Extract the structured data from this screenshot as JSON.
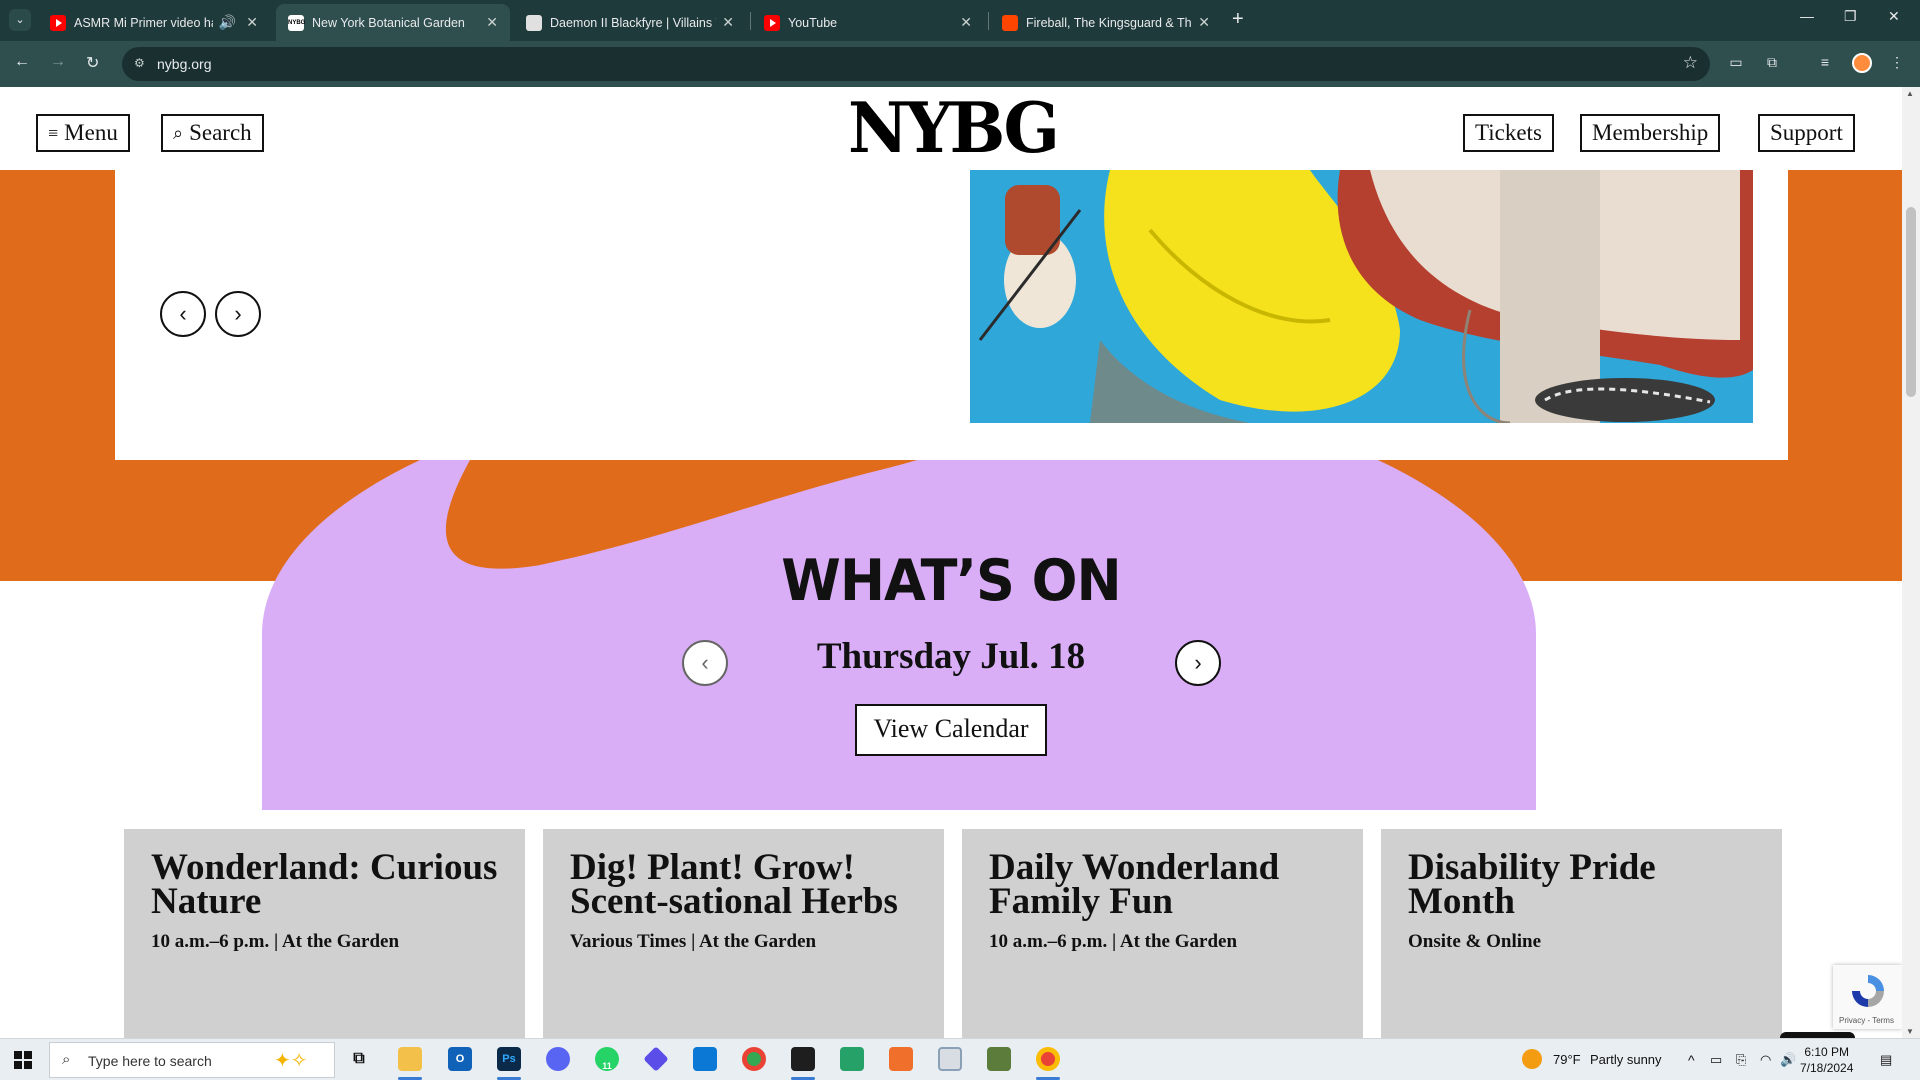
{
  "browser": {
    "tabs": [
      {
        "title": "ASMR Mi Primer video haci",
        "favicon": "youtube-icon",
        "audio": true
      },
      {
        "title": "New York Botanical Garden",
        "favicon": "nybg-icon",
        "active": true
      },
      {
        "title": "Daemon II Blackfyre | Villains W",
        "favicon": "fandom-icon"
      },
      {
        "title": "YouTube",
        "favicon": "youtube-icon"
      },
      {
        "title": "Fireball, The Kingsguard & The",
        "favicon": "reddit-icon"
      }
    ],
    "url": "nybg.org"
  },
  "header": {
    "menu_label": "Menu",
    "search_label": "Search",
    "logo": "NYBG",
    "tickets_label": "Tickets",
    "membership_label": "Membership",
    "support_label": "Support"
  },
  "whats_on": {
    "heading": "WHAT’S ON",
    "date": "Thursday Jul. 18",
    "view_calendar_label": "View Calendar"
  },
  "events": [
    {
      "title": "Wonderland: Curious Nature",
      "detail": "10 a.m.–6 p.m. | At the Garden"
    },
    {
      "title": "Dig! Plant! Grow! Scent-sational Herbs",
      "detail": "Various Times | At the Garden"
    },
    {
      "title": "Daily Wonderland Family Fun",
      "detail": "10 a.m.–6 p.m. | At the Garden"
    },
    {
      "title": "Disability Pride Month",
      "detail": "Onsite & Online"
    }
  ],
  "recaptcha": {
    "text": "Privacy - Terms"
  },
  "taskbar": {
    "search_placeholder": "Type here to search",
    "weather_temp": "79°F",
    "weather_desc": "Partly sunny",
    "time": "6:10 PM",
    "date": "7/18/2024",
    "whatsapp_badge": "11"
  },
  "colors": {
    "orange": "#e06c1b",
    "lavender": "#d9aef7",
    "card_gray": "#d0d0d0",
    "chrome_dark": "#1f3a3a"
  }
}
